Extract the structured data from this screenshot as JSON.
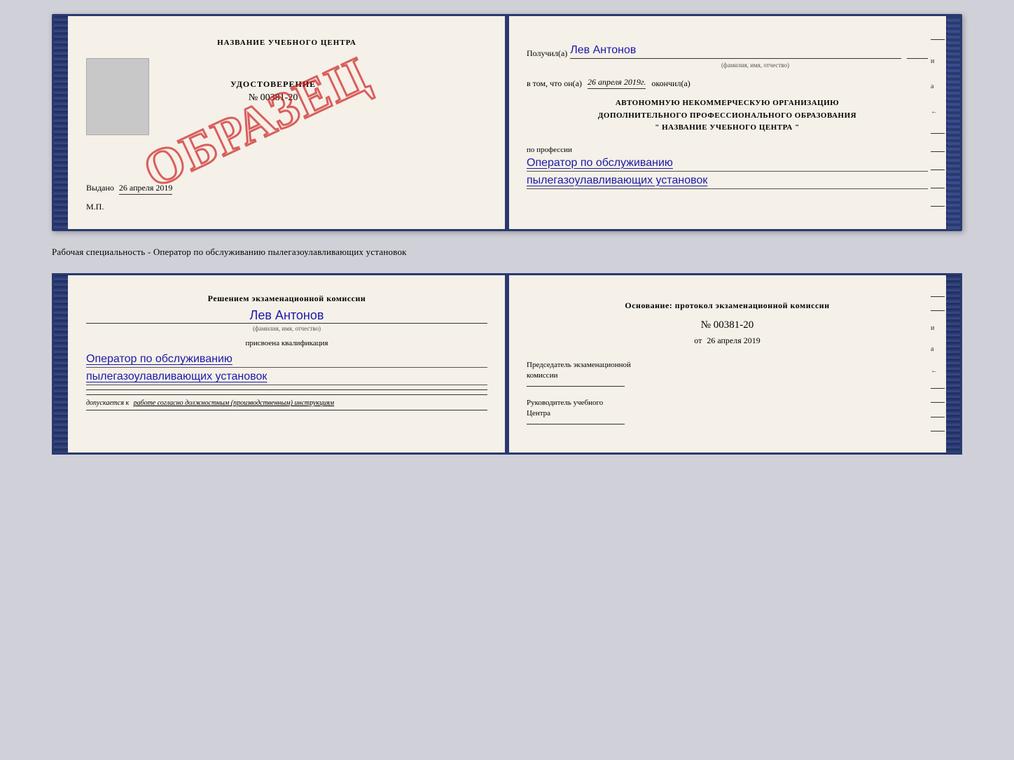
{
  "upper": {
    "left": {
      "school_name": "НАЗВАНИЕ УЧЕБНОГО ЦЕНТРА",
      "doc_title": "УДОСТОВЕРЕНИЕ",
      "doc_number": "№ 00381-20",
      "vydano_label": "Выдано",
      "vydano_date": "26 апреля 2019",
      "mp_label": "М.П.",
      "watermark": "ОБРАЗЕЦ"
    },
    "right": {
      "poluchil_label": "Получил(а)",
      "recipient_name": "Лев Антонов",
      "fio_label": "(фамилия, имя, отчество)",
      "vtom_label": "в том, что он(а)",
      "vtom_date": "26 апреля 2019г.",
      "okonchil_label": "окончил(а)",
      "org_line1": "АВТОНОМНУЮ НЕКОММЕРЧЕСКУЮ ОРГАНИЗАЦИЮ",
      "org_line2": "ДОПОЛНИТЕЛЬНОГО ПРОФЕССИОНАЛЬНОГО ОБРАЗОВАНИЯ",
      "org_line3": "\" НАЗВАНИЕ УЧЕБНОГО ЦЕНТРА \"",
      "po_professii_label": "по профессии",
      "profession_line1": "Оператор по обслуживанию",
      "profession_line2": "пылегазоулавливающих установок"
    }
  },
  "middle_text": "Рабочая специальность - Оператор по обслуживанию пылегазоулавливающих установок",
  "lower": {
    "left": {
      "commission_text1": "Решением экзаменационной комиссии",
      "person_name": "Лев Антонов",
      "fio_label": "(фамилия, имя, отчество)",
      "prisvoena_label": "присвоена квалификация",
      "kvalif_line1": "Оператор по обслуживанию",
      "kvalif_line2": "пылегазоулавливающих установок",
      "dopuskaetsya_prefix": "допускается к",
      "dopusk_text": "работе согласно должностным (производственным) инструкциям"
    },
    "right": {
      "osnovanie_label": "Основание: протокол экзаменационной комиссии",
      "protocol_number": "№ 00381-20",
      "ot_label": "от",
      "ot_date": "26 апреля 2019",
      "predsedatel_label1": "Председатель экзаменационной",
      "predsedatel_label2": "комиссии",
      "rukovoditel_label1": "Руководитель учебного",
      "rukovoditel_label2": "Центра"
    }
  },
  "side_items": [
    "и",
    "а",
    "←",
    "–",
    "–",
    "–",
    "–",
    "–"
  ]
}
